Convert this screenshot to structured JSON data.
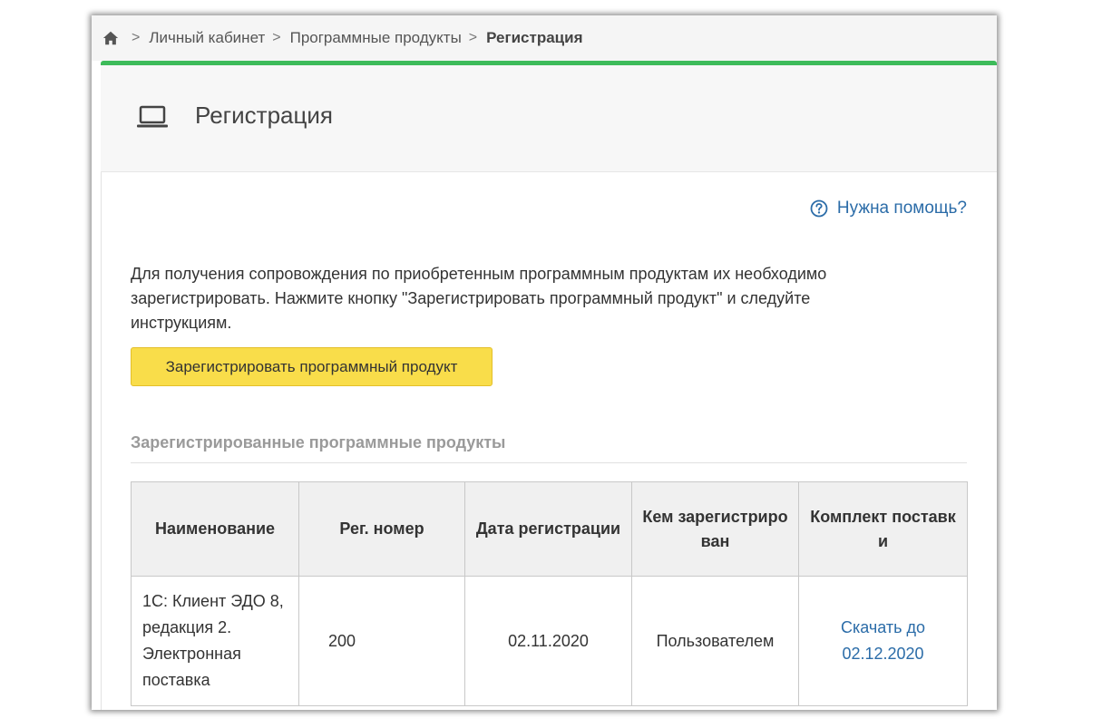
{
  "breadcrumb": {
    "home_icon": "home-icon",
    "items": [
      "Личный кабинет",
      "Программные продукты"
    ],
    "current": "Регистрация",
    "separator": ">"
  },
  "header": {
    "icon": "laptop-icon",
    "title": "Регистрация",
    "accent_color": "#3dbb5a"
  },
  "help": {
    "icon": "question-circle-icon",
    "label": "Нужна помощь?"
  },
  "intro": {
    "text": "Для получения сопровождения по приобретенным программным продуктам их необходимо зарегистрировать. Нажмите кнопку \"Зарегистрировать программный продукт\" и следуйте инструкциям."
  },
  "register_button": {
    "label": "Зарегистрировать программный продукт",
    "color": "#f9dd4a"
  },
  "section": {
    "title": "Зарегистрированные программные продукты"
  },
  "table": {
    "headers": [
      "Наименование",
      "Рег. номер",
      "Дата регистрации",
      "Кем зарегистрирован",
      "Комплект поставки"
    ],
    "rows": [
      {
        "name": "1С: Клиент ЭДО 8, редакция 2. Электронная поставка",
        "reg_number": "200",
        "date": "02.11.2020",
        "registered_by": "Пользователем",
        "kit": "Скачать до 02.12.2020"
      }
    ]
  },
  "link_color": "#2b6ca8"
}
